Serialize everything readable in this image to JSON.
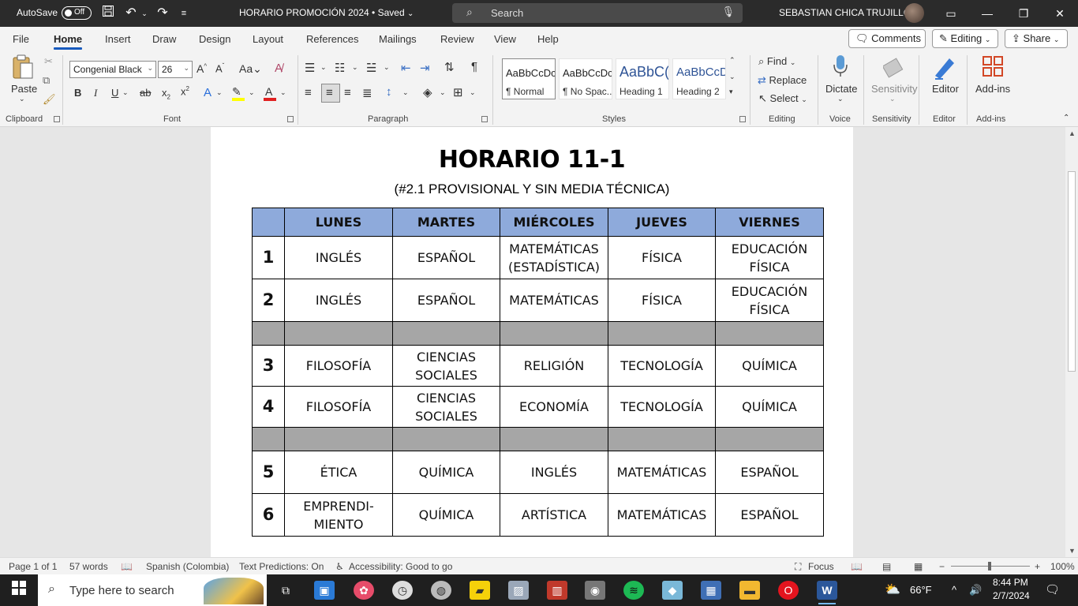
{
  "titlebar": {
    "autosave_label": "AutoSave",
    "autosave_state": "Off",
    "doc_title": "HORARIO PROMOCIÓN 2024",
    "save_state": "Saved",
    "search_placeholder": "Search",
    "user_name": "SEBASTIAN CHICA TRUJILLO"
  },
  "menu": {
    "tabs": [
      "File",
      "Home",
      "Insert",
      "Draw",
      "Design",
      "Layout",
      "References",
      "Mailings",
      "Review",
      "View",
      "Help"
    ],
    "active_tab": "Home",
    "comments_label": "Comments",
    "editing_label": "Editing",
    "share_label": "Share"
  },
  "ribbon": {
    "clipboard": {
      "paste_label": "Paste",
      "group_label": "Clipboard"
    },
    "font": {
      "font_name": "Congenial Black",
      "font_size": "26",
      "group_label": "Font"
    },
    "paragraph": {
      "group_label": "Paragraph"
    },
    "styles": {
      "items": [
        {
          "sample": "AaBbCcDc",
          "name": "¶ Normal"
        },
        {
          "sample": "AaBbCcDc",
          "name": "¶ No Spac..."
        },
        {
          "sample": "AaBbC(",
          "name": "Heading 1"
        },
        {
          "sample": "AaBbCcD",
          "name": "Heading 2"
        }
      ],
      "group_label": "Styles"
    },
    "editing": {
      "find_label": "Find",
      "replace_label": "Replace",
      "select_label": "Select",
      "group_label": "Editing"
    },
    "voice": {
      "dictate_label": "Dictate",
      "group_label": "Voice"
    },
    "sensitivity": {
      "label": "Sensitivity",
      "group_label": "Sensitivity"
    },
    "editor": {
      "label": "Editor",
      "group_label": "Editor"
    },
    "addins": {
      "label": "Add-ins",
      "group_label": "Add-ins"
    }
  },
  "document": {
    "title": "HORARIO 11-1",
    "subtitle": "(#2.1 PROVISIONAL Y SIN MEDIA TÉCNICA)",
    "headers": [
      "LUNES",
      "MARTES",
      "MIÉRCOLES",
      "JUEVES",
      "VIERNES"
    ],
    "rows": [
      {
        "num": "1",
        "cells": [
          "INGLÉS",
          "ESPAÑOL",
          "MATEMÁTICAS (ESTADÍSTICA)",
          "FÍSICA",
          "EDUCACIÓN FÍSICA"
        ]
      },
      {
        "num": "2",
        "cells": [
          "INGLÉS",
          "ESPAÑOL",
          "MATEMÁTICAS",
          "FÍSICA",
          "EDUCACIÓN FÍSICA"
        ]
      },
      {
        "num": "3",
        "cells": [
          "FILOSOFÍA",
          "CIENCIAS SOCIALES",
          "RELIGIÓN",
          "TECNOLOGÍA",
          "QUÍMICA"
        ]
      },
      {
        "num": "4",
        "cells": [
          "FILOSOFÍA",
          "CIENCIAS SOCIALES",
          "ECONOMÍA",
          "TECNOLOGÍA",
          "QUÍMICA"
        ]
      },
      {
        "num": "5",
        "cells": [
          "ÉTICA",
          "QUÍMICA",
          "INGLÉS",
          "MATEMÁTICAS",
          "ESPAÑOL"
        ]
      },
      {
        "num": "6",
        "cells": [
          "EMPRENDI-MIENTO",
          "QUÍMICA",
          "ARTÍSTICA",
          "MATEMÁTICAS",
          "ESPAÑOL"
        ]
      }
    ]
  },
  "status": {
    "page": "Page 1 of 1",
    "words": "57 words",
    "language": "Spanish (Colombia)",
    "text_predictions": "Text Predictions: On",
    "accessibility": "Accessibility: Good to go",
    "focus": "Focus",
    "zoom": "100%"
  },
  "taskbar": {
    "search_placeholder": "Type here to search",
    "weather": "66°F",
    "time": "8:44 PM",
    "date": "2/7/2024"
  },
  "colors": {
    "header_fill": "#8eaadb",
    "break_fill": "#a6a6a6",
    "accent": "#185abd",
    "titlebar": "#2b2b2b"
  }
}
